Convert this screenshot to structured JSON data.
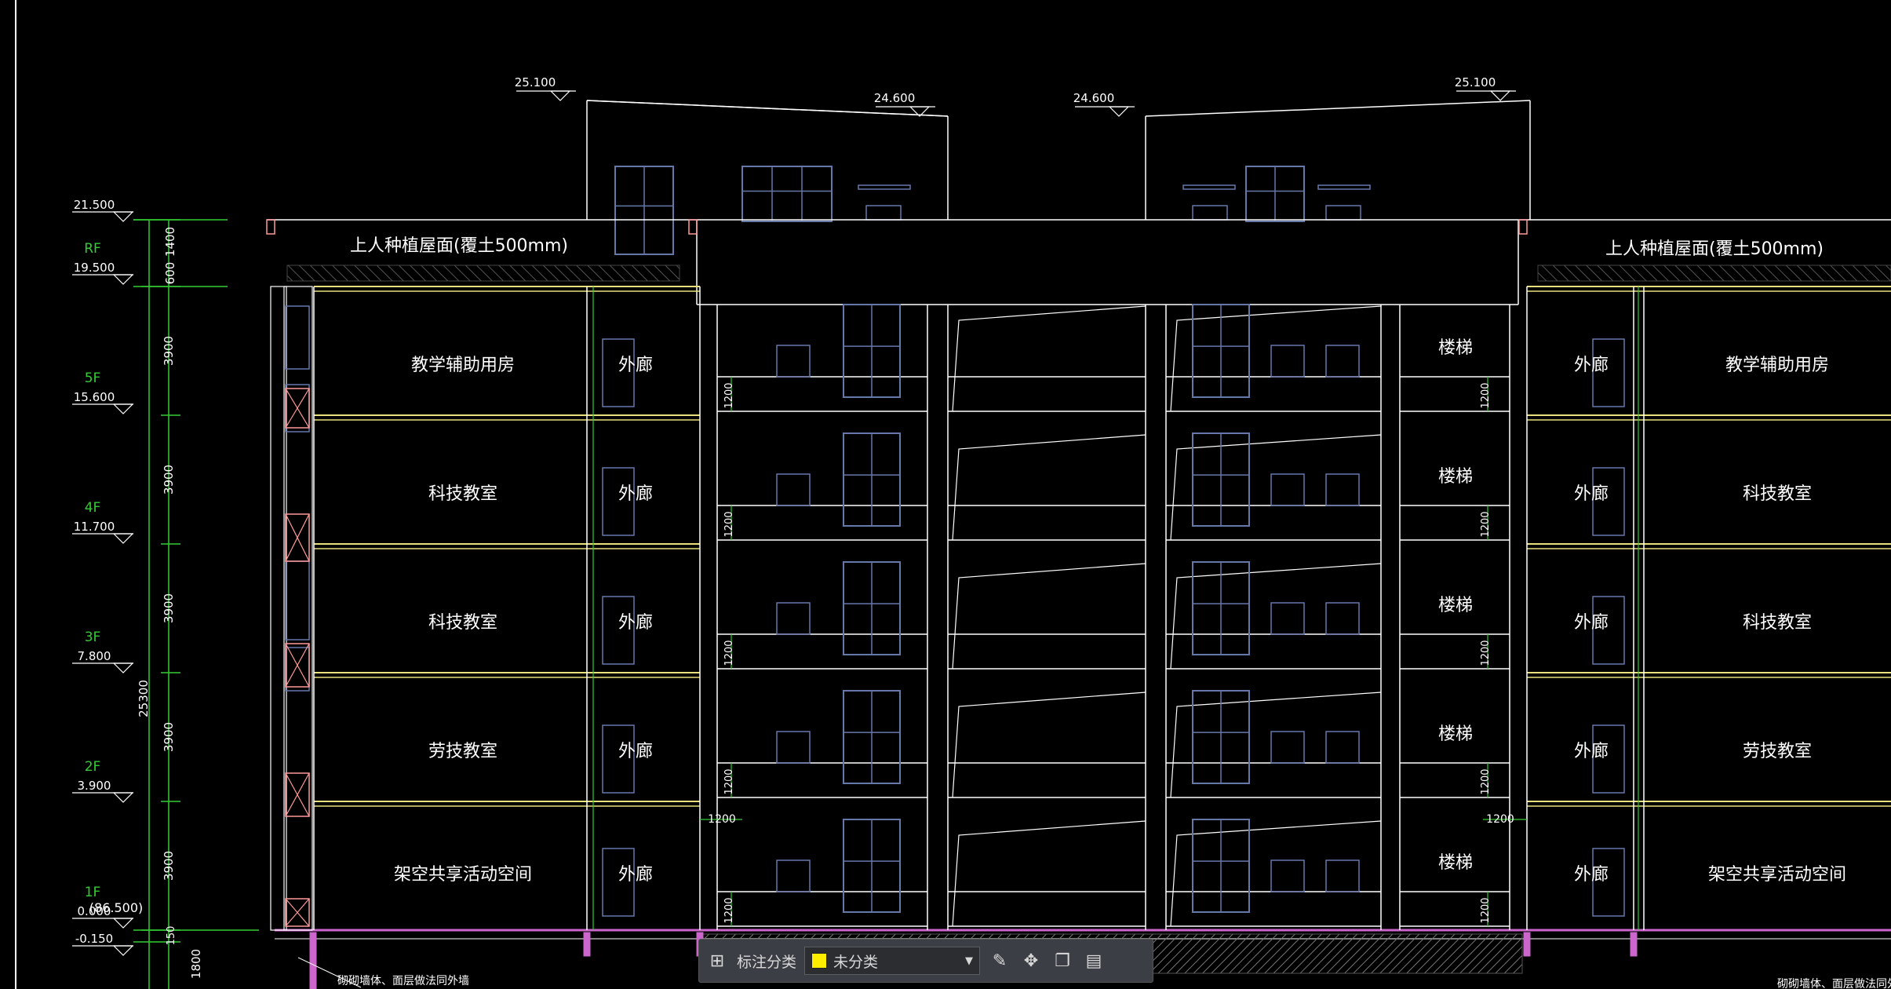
{
  "elevation_marks": [
    {
      "id": "rf_top",
      "value": "21.500",
      "level": ""
    },
    {
      "id": "rf",
      "value": "19.500",
      "level": "RF"
    },
    {
      "id": "f5",
      "value": "15.600",
      "level": "5F"
    },
    {
      "id": "f4",
      "value": "11.700",
      "level": "4F"
    },
    {
      "id": "f3",
      "value": "7.800",
      "level": "3F"
    },
    {
      "id": "f2",
      "value": "3.900",
      "level": "2F"
    },
    {
      "id": "f1",
      "value": "0.000",
      "level": "1F"
    },
    {
      "id": "ground",
      "value": "-0.150",
      "level": ""
    }
  ],
  "ground_abs": "(86.500)",
  "roof_elevations": [
    "25.100",
    "24.600",
    "24.600",
    "25.100"
  ],
  "dims": {
    "total": "25300",
    "floor": "3900",
    "parapet_a": "1400",
    "parapet_b": "600",
    "plinth": "150",
    "below": "1800",
    "rail": "1200"
  },
  "roof_label": "上人种植屋面(覆土500mm)",
  "rooms_left": [
    "教学辅助用房",
    "科技教室",
    "科技教室",
    "劳技教室",
    "架空共享活动空间"
  ],
  "rooms_right": [
    "教学辅助用房",
    "科技教室",
    "科技教室",
    "劳技教室",
    "架空共享活动空间"
  ],
  "corridor": "外廊",
  "stair": "楼梯",
  "notes": {
    "bottom_left": "砌砌墙体、面层做法同外墙",
    "bottom_right": "砌砌墙体、面层做法同外墙"
  },
  "toolbar": {
    "category_label": "标注分类",
    "select_value": "未分类",
    "swatch_color": "#ffee00"
  },
  "icons": {
    "grid": "grid-icon",
    "edit": "edit-icon",
    "move": "move-icon",
    "copy": "copy-icon",
    "paste": "paste-icon"
  },
  "colors": {
    "background": "#000000",
    "lines": "#ffffff",
    "dim": "#33cc33",
    "slab": "#e8e07a",
    "window": "#6677aa",
    "column": "#ff9999",
    "pipe": "#cc66cc"
  }
}
